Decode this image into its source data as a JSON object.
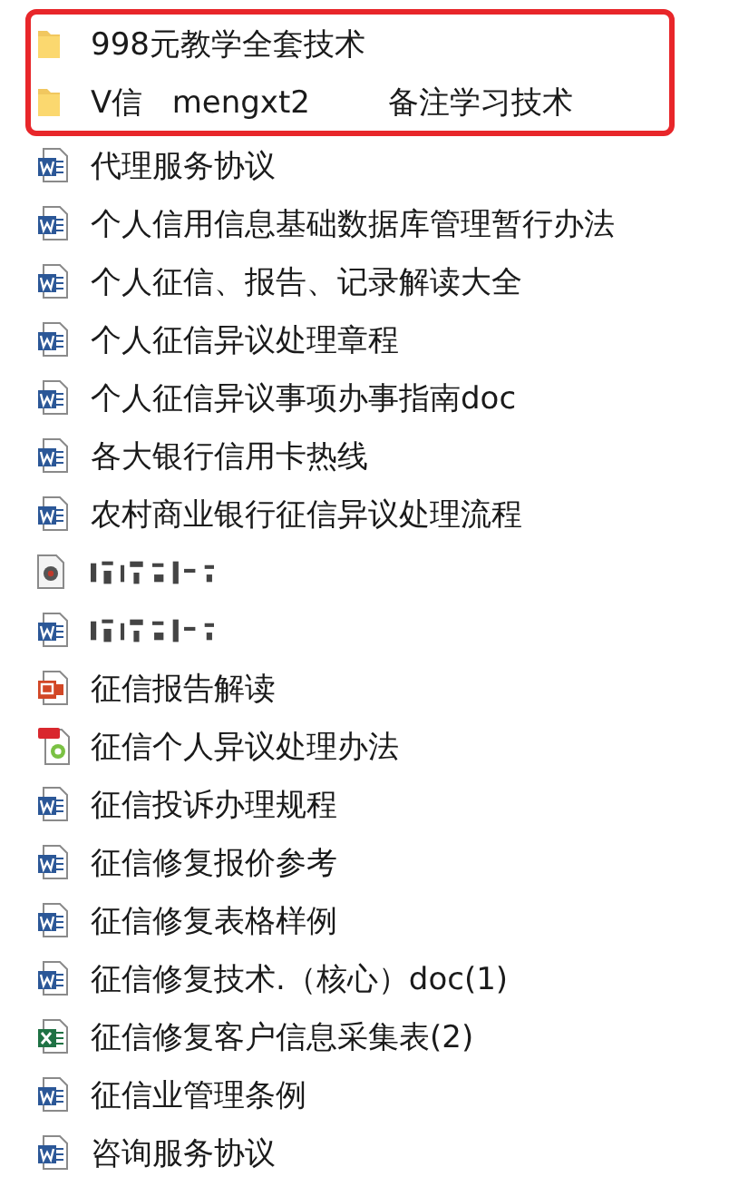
{
  "highlighted_items": [
    {
      "kind": "folder",
      "name": "998元教学全套技术"
    },
    {
      "kind": "folder",
      "name": "V信   mengxt2        备注学习技术"
    }
  ],
  "items": [
    {
      "kind": "word",
      "name": "代理服务协议"
    },
    {
      "kind": "word",
      "name": "个人信用信息基础数据库管理暂行办法"
    },
    {
      "kind": "word",
      "name": "个人征信、报告、记录解读大全"
    },
    {
      "kind": "word",
      "name": "个人征信异议处理章程"
    },
    {
      "kind": "word",
      "name": "个人征信异议事项办事指南doc"
    },
    {
      "kind": "word",
      "name": "各大银行信用卡热线"
    },
    {
      "kind": "word",
      "name": "农村商业银行征信异议处理流程"
    },
    {
      "kind": "media",
      "obscured": true
    },
    {
      "kind": "word",
      "obscured": true
    },
    {
      "kind": "ppt",
      "name": "征信报告解读"
    },
    {
      "kind": "pdf",
      "name": "征信个人异议处理办法"
    },
    {
      "kind": "word",
      "name": "征信投诉办理规程"
    },
    {
      "kind": "word",
      "name": "征信修复报价参考"
    },
    {
      "kind": "word",
      "name": "征信修复表格样例"
    },
    {
      "kind": "word",
      "name": "征信修复技术.（核心）doc(1)"
    },
    {
      "kind": "excel",
      "name": "征信修复客户信息采集表(2)"
    },
    {
      "kind": "word",
      "name": "征信业管理条例"
    },
    {
      "kind": "word",
      "name": "咨询服务协议"
    }
  ]
}
